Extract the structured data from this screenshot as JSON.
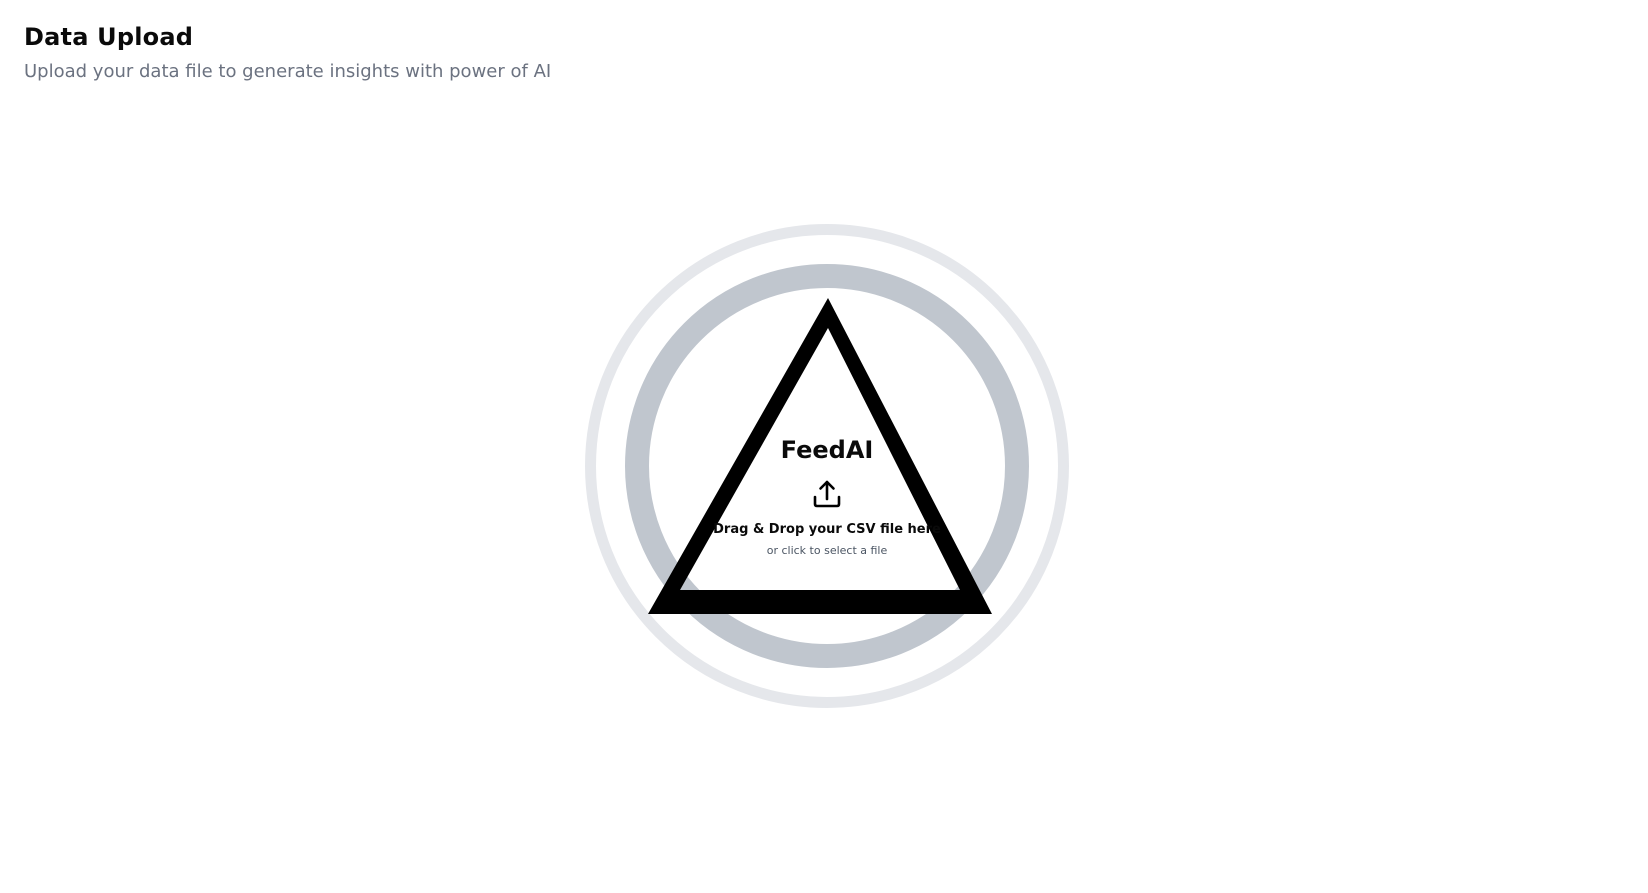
{
  "header": {
    "title": "Data Upload",
    "subtitle": "Upload your data file to generate insights with power of AI"
  },
  "dropzone": {
    "brand": "FeedAI",
    "icon": "upload-icon",
    "label": "Drag & Drop your CSV file here",
    "hint": "or click to select a file"
  },
  "colors": {
    "outer_ring": "#e5e7eb",
    "inner_ring": "#c0c6ce",
    "triangle": "#000000",
    "subtitle": "#6b7280"
  }
}
